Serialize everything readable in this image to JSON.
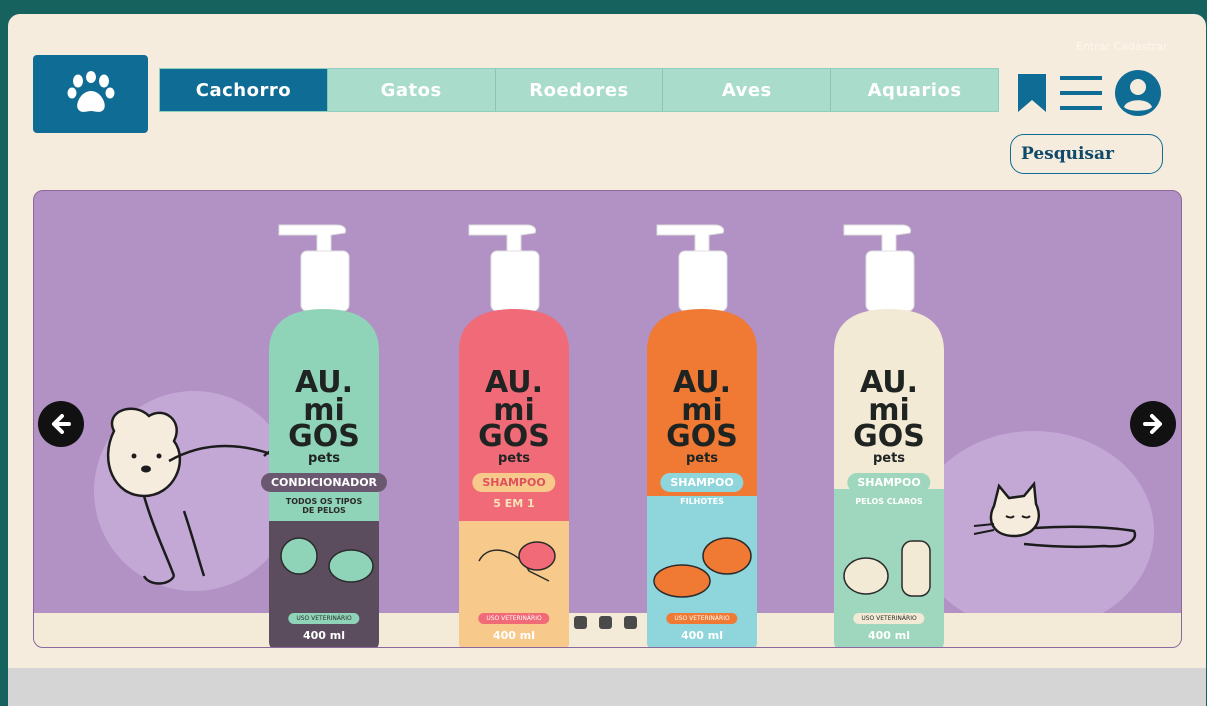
{
  "nav": {
    "tabs": [
      {
        "label": "Cachorro",
        "active": true
      },
      {
        "label": "Gatos",
        "active": false
      },
      {
        "label": "Roedores",
        "active": false
      },
      {
        "label": "Aves",
        "active": false
      },
      {
        "label": "Aquarios",
        "active": false
      }
    ]
  },
  "header": {
    "logo_icon": "paw-icon",
    "icons": [
      "bookmark-icon",
      "menu-icon",
      "user-icon"
    ],
    "search_label": "Pesquisar",
    "faint_text": "Entrar   Cadastrar"
  },
  "carousel": {
    "products": [
      {
        "brand_line1": "AU.",
        "brand_line2": "mi",
        "brand_line3": "GOS",
        "brand_line4": "pets",
        "type": "CONDICIONADOR",
        "subtitle": "TODOS OS TIPOS DE PELOS",
        "vet": "USO VETERINÁRIO",
        "volume": "400 ml"
      },
      {
        "brand_line1": "AU.",
        "brand_line2": "mi",
        "brand_line3": "GOS",
        "brand_line4": "pets",
        "type": "SHAMPOO",
        "subtitle": "5 EM 1",
        "vet": "USO VETERINÁRIO",
        "volume": "400 ml"
      },
      {
        "brand_line1": "AU.",
        "brand_line2": "mi",
        "brand_line3": "GOS",
        "brand_line4": "pets",
        "type": "SHAMPOO",
        "subtitle": "FILHOTES",
        "vet": "USO VETERINÁRIO",
        "volume": "400 ml"
      },
      {
        "brand_line1": "AU.",
        "brand_line2": "mi",
        "brand_line3": "GOS",
        "brand_line4": "pets",
        "type": "SHAMPOO",
        "subtitle": "PELOS CLAROS",
        "vet": "USO VETERINÁRIO",
        "volume": "400 ml"
      }
    ],
    "slide_count": 3,
    "prev_icon": "arrow-left-icon",
    "next_icon": "arrow-right-icon"
  },
  "colors": {
    "primary": "#0f6c94",
    "tab_inactive": "#a9dccb",
    "banner_bg": "#b291c4",
    "page_bg": "#f6ecdd",
    "frame_border": "#16625f"
  }
}
